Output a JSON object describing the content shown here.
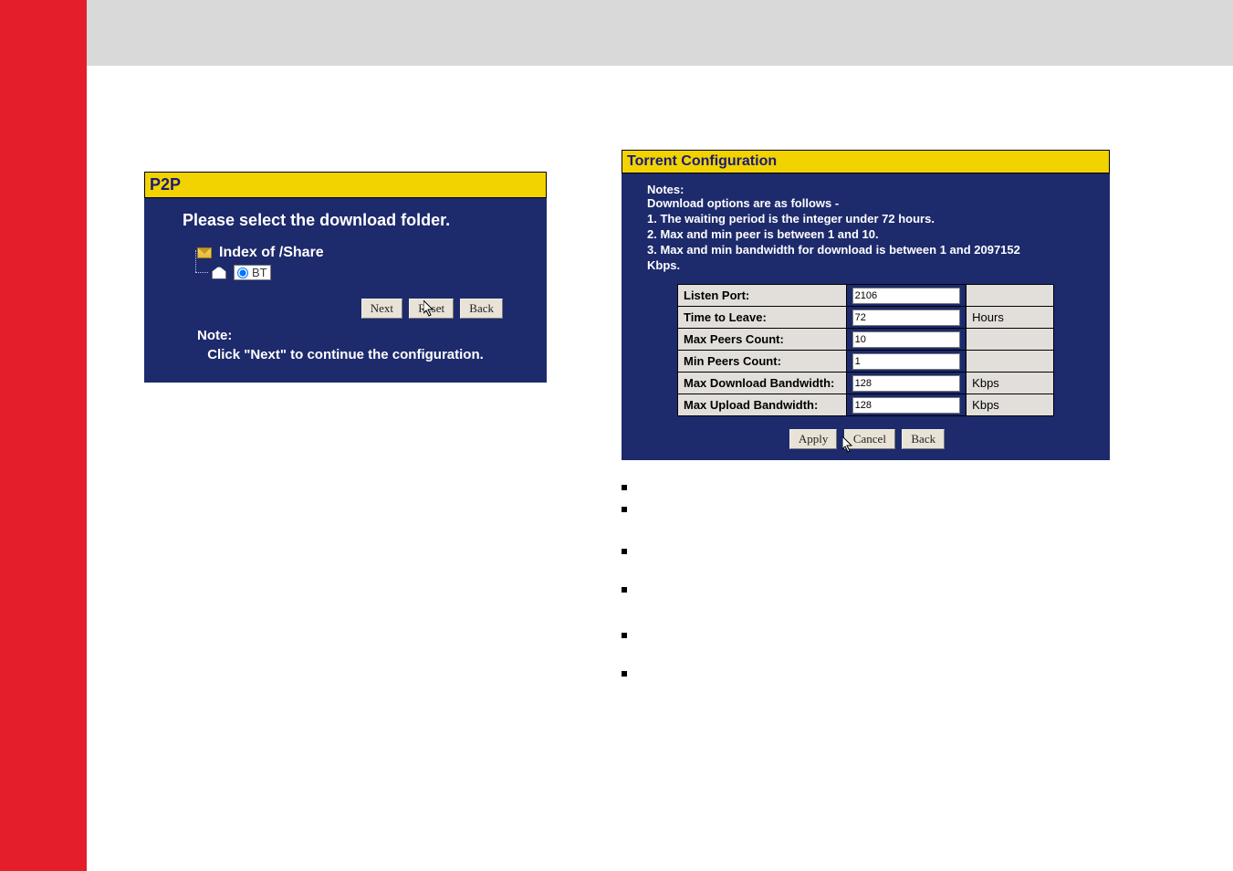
{
  "left_panel": {
    "titlebar": "P2P",
    "heading": "Please select the download folder.",
    "tree": {
      "root_label": "Index of /Share",
      "child_label": "BT"
    },
    "buttons": {
      "next": "Next",
      "reset": "Reset",
      "back": "Back"
    },
    "note_label": "Note:",
    "note_text": "Click \"Next\" to continue the configuration."
  },
  "right_panel": {
    "titlebar": "Torrent Configuration",
    "notes_label": "Notes:",
    "notes_lines": [
      "Download options are as follows -",
      "1. The waiting period is the integer under 72 hours.",
      "2. Max and min peer is between 1 and 10.",
      "3. Max and min bandwidth for download is between 1 and 2097152 Kbps."
    ],
    "rows": [
      {
        "label": "Listen Port:",
        "value": "2106",
        "unit": ""
      },
      {
        "label": "Time to Leave:",
        "value": "72",
        "unit": "Hours"
      },
      {
        "label": "Max Peers Count:",
        "value": "10",
        "unit": ""
      },
      {
        "label": "Min Peers Count:",
        "value": "1",
        "unit": ""
      },
      {
        "label": "Max Download Bandwidth:",
        "value": "128",
        "unit": "Kbps"
      },
      {
        "label": "Max Upload Bandwidth:",
        "value": "128",
        "unit": "Kbps"
      }
    ],
    "buttons": {
      "apply": "Apply",
      "cancel": "Cancel",
      "back": "Back"
    }
  }
}
